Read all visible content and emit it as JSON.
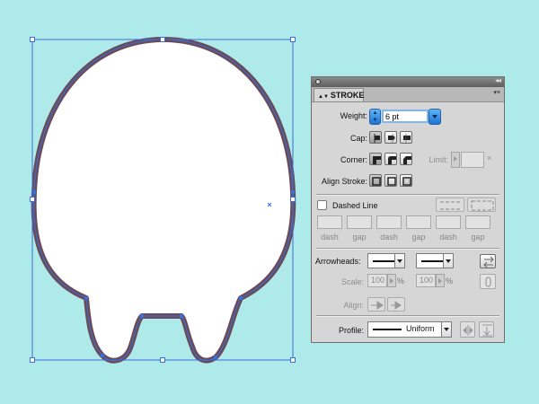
{
  "panel": {
    "tab_title": "STROKE",
    "tab_arrows": "▲▼",
    "menu_glyph": "▾≡",
    "collapse_glyph": "◂◂",
    "weight_label": "Weight:",
    "weight_value": "6 pt",
    "cap_label": "Cap:",
    "corner_label": "Corner:",
    "limit_label": "Limit:",
    "limit_x": "×",
    "align_stroke_label": "Align Stroke:",
    "dashed_line_label": "Dashed Line",
    "dashed_line_checked": false,
    "dash_gap_labels": [
      "dash",
      "gap",
      "dash",
      "gap",
      "dash",
      "gap"
    ],
    "arrowheads_label": "Arrowheads:",
    "scale_label": "Scale:",
    "scale_start": "100",
    "scale_end": "100",
    "percent_sign": "%",
    "align_label": "Align:",
    "profile_label": "Profile:",
    "profile_value": "Uniform"
  },
  "colors": {
    "background": "#aeeaea",
    "shape_fill": "#ffffff",
    "shape_stroke": "#6a4b58",
    "selection": "#3b6fd6",
    "focus_blue": "#2a84e6"
  },
  "icons": {
    "cap": [
      "butt-cap-icon",
      "round-cap-icon",
      "projecting-cap-icon"
    ],
    "corner": [
      "miter-join-icon",
      "round-join-icon",
      "bevel-join-icon"
    ],
    "align": [
      "align-center-icon",
      "align-inside-icon",
      "align-outside-icon"
    ],
    "arrows": [
      "swap-arrows-icon",
      "link-scale-icon",
      "flip-profile-icon",
      "reset-profile-icon"
    ]
  }
}
